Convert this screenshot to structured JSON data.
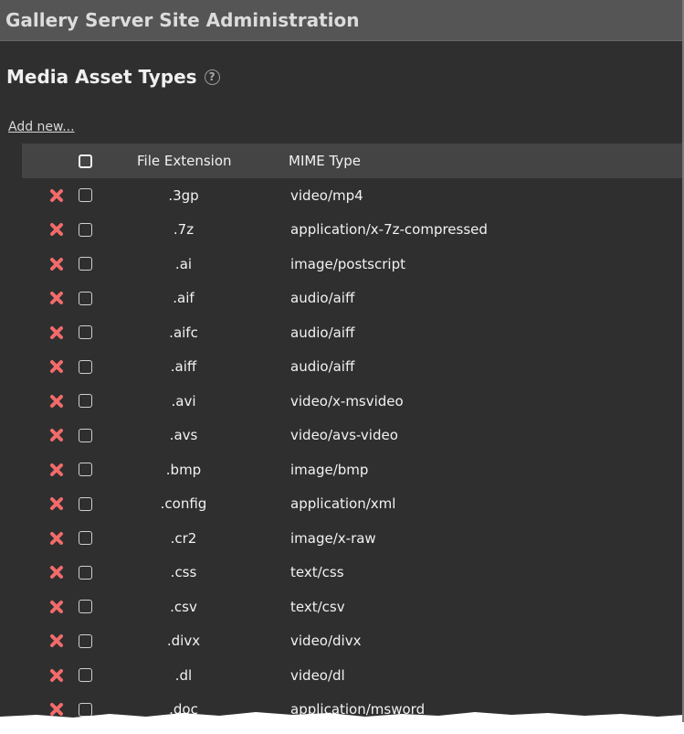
{
  "header": {
    "title": "Gallery Server Site Administration"
  },
  "section": {
    "title": "Media Asset Types",
    "help": "?"
  },
  "add_new_label": "Add new...",
  "table": {
    "columns": {
      "file_extension": "File Extension",
      "mime_type": "MIME Type"
    },
    "rows": [
      {
        "ext": ".3gp",
        "mime": "video/mp4"
      },
      {
        "ext": ".7z",
        "mime": "application/x-7z-compressed"
      },
      {
        "ext": ".ai",
        "mime": "image/postscript"
      },
      {
        "ext": ".aif",
        "mime": "audio/aiff"
      },
      {
        "ext": ".aifc",
        "mime": "audio/aiff"
      },
      {
        "ext": ".aiff",
        "mime": "audio/aiff"
      },
      {
        "ext": ".avi",
        "mime": "video/x-msvideo"
      },
      {
        "ext": ".avs",
        "mime": "video/avs-video"
      },
      {
        "ext": ".bmp",
        "mime": "image/bmp"
      },
      {
        "ext": ".config",
        "mime": "application/xml"
      },
      {
        "ext": ".cr2",
        "mime": "image/x-raw"
      },
      {
        "ext": ".css",
        "mime": "text/css"
      },
      {
        "ext": ".csv",
        "mime": "text/csv"
      },
      {
        "ext": ".divx",
        "mime": "video/divx"
      },
      {
        "ext": ".dl",
        "mime": "video/dl"
      },
      {
        "ext": ".doc",
        "mime": "application/msword"
      }
    ]
  },
  "colors": {
    "delete": "#f26b6b",
    "header_bar": "#555555",
    "background": "#2f2f2f"
  },
  "icons": {
    "delete": "delete-x-icon",
    "help": "help-circle-icon"
  }
}
